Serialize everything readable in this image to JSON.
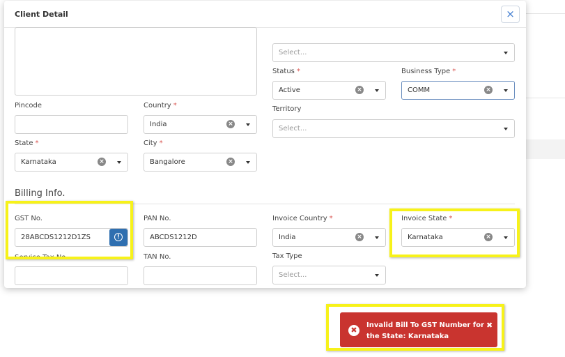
{
  "modal": {
    "title": "Client Detail",
    "close_glyph": "×"
  },
  "fields": {
    "top_select_placeholder": "Select...",
    "status": {
      "label": "Status",
      "value": "Active"
    },
    "business_type": {
      "label": "Business Type",
      "value": "COMM"
    },
    "territory": {
      "label": "Territory",
      "placeholder": "Select..."
    },
    "pincode": {
      "label": "Pincode",
      "value": ""
    },
    "country": {
      "label": "Country",
      "value": "India"
    },
    "state": {
      "label": "State",
      "value": "Karnataka"
    },
    "city": {
      "label": "City",
      "value": "Bangalore"
    }
  },
  "billing": {
    "section_title": "Billing Info.",
    "gst_no": {
      "label": "GST No.",
      "value": "28ABCDS1212D1ZS"
    },
    "pan_no": {
      "label": "PAN No.",
      "value": "ABCDS1212D"
    },
    "invoice_country": {
      "label": "Invoice Country",
      "value": "India"
    },
    "invoice_state": {
      "label": "Invoice State",
      "value": "Karnataka"
    },
    "tan_no": {
      "label": "TAN No.",
      "value": ""
    },
    "tax_type": {
      "label": "Tax Type",
      "placeholder": "Select..."
    },
    "service_tax_label_partial": "Service Tax No."
  },
  "required_marker": "*",
  "toast": {
    "message": "Invalid Bill To GST Number for the State: Karnataka",
    "close_glyph": "✖",
    "icon_glyph": "✖"
  },
  "colors": {
    "highlight": "#f7f21a",
    "toast_bg": "#c9342f",
    "accent": "#2f6fb0",
    "required": "#d9534f"
  }
}
